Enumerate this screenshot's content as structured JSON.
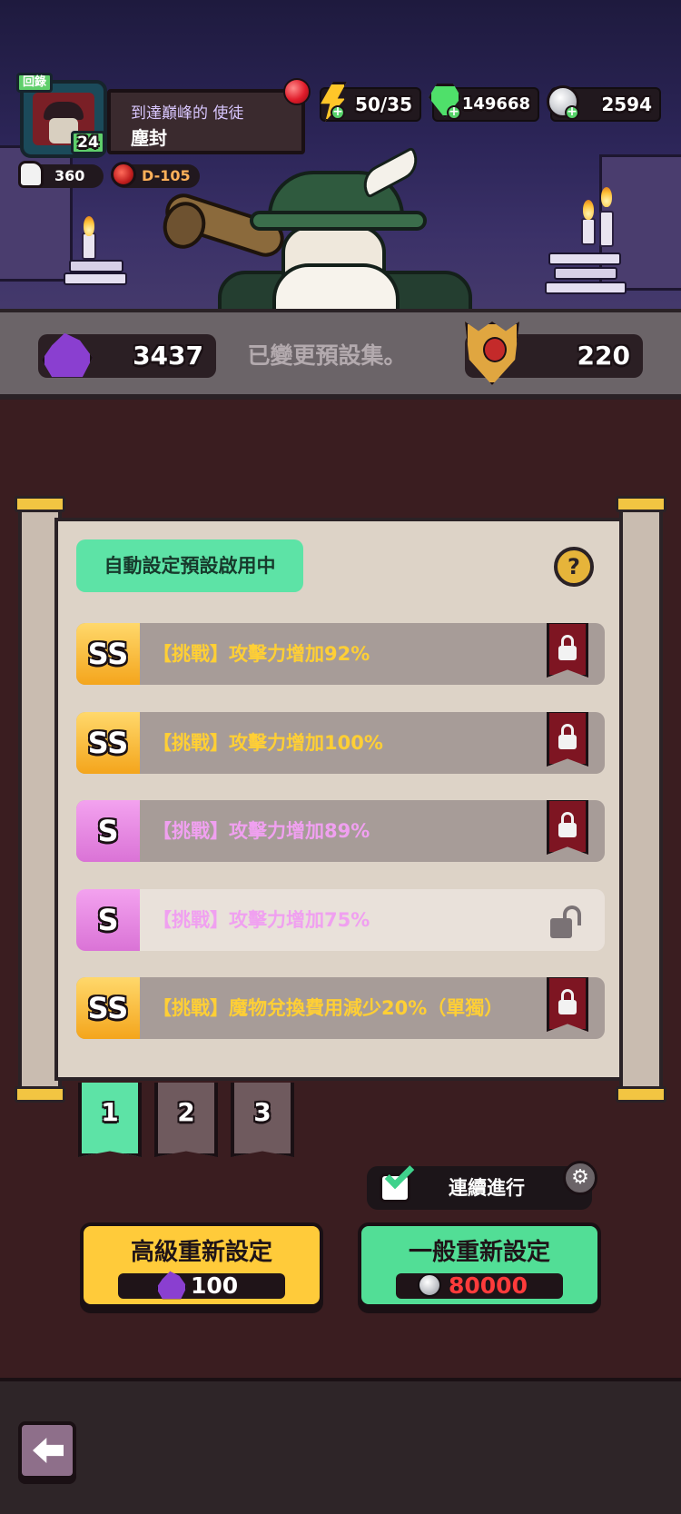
{
  "profile": {
    "badge": "回錄",
    "level": "24",
    "title": "到達巔峰的 使徒",
    "name": "塵封",
    "likes": "360",
    "stage": "D-105"
  },
  "resources": {
    "energy": "50/35",
    "gems": "149668",
    "coins": "2594"
  },
  "stone_bar": {
    "crystals": "3437",
    "message": "已變更預設集。",
    "crest_points": "220"
  },
  "panel": {
    "auto_tag": "自動設定預設啟用中",
    "help": "?",
    "options": [
      {
        "grade": "SS",
        "text": "【挑戰】攻擊力增加92%",
        "locked": true
      },
      {
        "grade": "SS",
        "text": "【挑戰】攻擊力增加100%",
        "locked": true
      },
      {
        "grade": "S",
        "text": "【挑戰】攻擊力增加89%",
        "locked": true
      },
      {
        "grade": "S",
        "text": "【挑戰】攻擊力增加75%",
        "locked": false
      },
      {
        "grade": "SS",
        "text": "【挑戰】魔物兌換費用減少20%（單獨）",
        "locked": true
      }
    ]
  },
  "presets": [
    "1",
    "2",
    "3"
  ],
  "active_preset": "1",
  "continue_label": "連續進行",
  "advanced_reset": {
    "label": "高級重新設定",
    "cost": "100"
  },
  "normal_reset": {
    "label": "一般重新設定",
    "cost": "80000"
  },
  "colors": {
    "accent_green": "#5de3a6",
    "gold": "#ffcb3a",
    "ss_text": "#ffcf35",
    "s_text": "#f0a0f0",
    "lock_red": "#7e1522"
  }
}
